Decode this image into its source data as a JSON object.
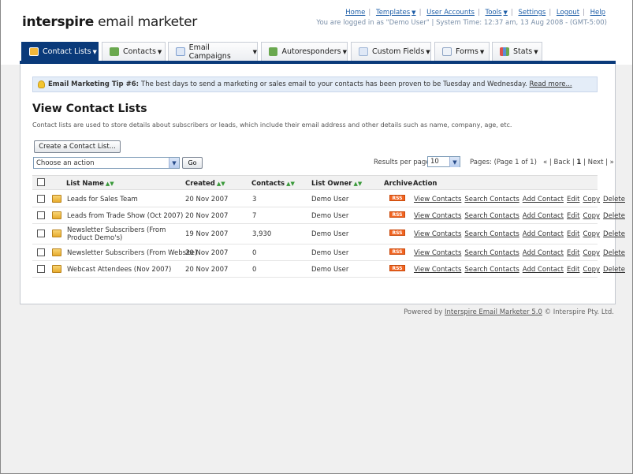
{
  "header": {
    "logo_bold": "interspire",
    "logo_rest": " email marketer",
    "links": [
      "Home",
      "Templates",
      "User Accounts",
      "Tools",
      "Settings",
      "Logout",
      "Help"
    ],
    "status": "You are logged in as \"Demo User\" | System Time: 12:37 am, 13 Aug 2008 - (GMT-5:00)"
  },
  "tabs": [
    {
      "label": "Contact Lists",
      "icon": "contact-lists-icon",
      "color": "#f2b73a"
    },
    {
      "label": "Contacts",
      "icon": "contacts-icon",
      "color": "#6aa84f"
    },
    {
      "label": "Email Campaigns",
      "icon": "email-campaigns-icon",
      "color": "#7f9fcf"
    },
    {
      "label": "Autoresponders",
      "icon": "autoresponders-icon",
      "color": "#6aa84f"
    },
    {
      "label": "Custom Fields",
      "icon": "custom-fields-icon",
      "color": "#9fb6d6"
    },
    {
      "label": "Forms",
      "icon": "forms-icon",
      "color": "#8ea4c4"
    },
    {
      "label": "Stats",
      "icon": "stats-icon",
      "color": "#d9534f"
    }
  ],
  "tip": {
    "label": "Email Marketing Tip #6:",
    "text": "The best days to send a marketing or sales email to your contacts has been proven to be Tuesday and Wednesday.",
    "link": "Read more..."
  },
  "page": {
    "title": "View Contact Lists",
    "description": "Contact lists are used to store details about subscribers or leads, which include their email address and other details such as name, company, age, etc.",
    "create_button": "Create a Contact List...",
    "action_placeholder": "Choose an action",
    "go_button": "Go",
    "results_label": "Results per page:",
    "results_value": "10",
    "pages_text": "Pages: (Page 1 of 1)",
    "pager_back": "| Back |",
    "pager_current": "1",
    "pager_next": "| Next |",
    "pager_first": "«",
    "pager_last": "»"
  },
  "table": {
    "headers": {
      "name": "List Name",
      "created": "Created",
      "contacts": "Contacts",
      "owner": "List Owner",
      "archive": "Archive",
      "action": "Action"
    },
    "rss_label": "RSS",
    "action_links": [
      "View Contacts",
      "Search Contacts",
      "Add Contact",
      "Edit",
      "Copy",
      "Delete"
    ],
    "rows": [
      {
        "name": "Leads for Sales Team",
        "created": "20 Nov 2007",
        "contacts": "3",
        "owner": "Demo User"
      },
      {
        "name": "Leads from Trade Show (Oct 2007)",
        "created": "20 Nov 2007",
        "contacts": "7",
        "owner": "Demo User"
      },
      {
        "name": "Newsletter Subscribers (From Product Demo's)",
        "created": "19 Nov 2007",
        "contacts": "3,930",
        "owner": "Demo User"
      },
      {
        "name": "Newsletter Subscribers (From Website)",
        "created": "20 Nov 2007",
        "contacts": "0",
        "owner": "Demo User"
      },
      {
        "name": "Webcast Attendees (Nov 2007)",
        "created": "20 Nov 2007",
        "contacts": "0",
        "owner": "Demo User"
      }
    ]
  },
  "footer": {
    "prefix": "Powered by",
    "link": "Interspire Email Marketer 5.0",
    "suffix": "© Interspire Pty. Ltd."
  }
}
